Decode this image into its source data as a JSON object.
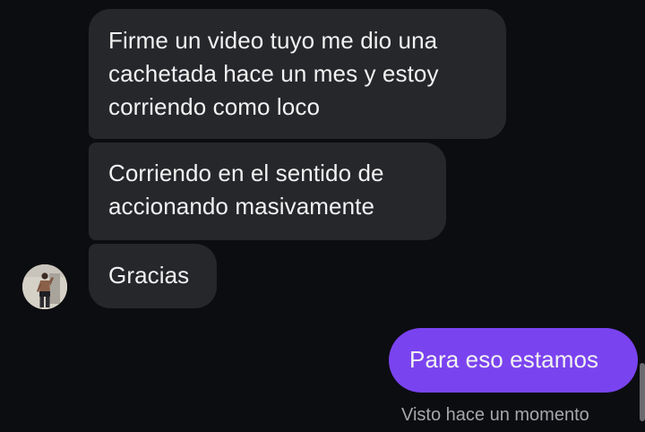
{
  "messages": [
    {
      "lines": [
        "Firme un video tuyo me dio una",
        "cachetada hace un mes y estoy",
        "corriendo como loco"
      ]
    },
    {
      "lines": [
        "Corriendo en el sentido de",
        "accionando masivamente"
      ]
    },
    {
      "lines": [
        "Gracias"
      ]
    }
  ],
  "reply": {
    "text": "Para eso estamos"
  },
  "seen_status": "Visto hace un momento",
  "colors": {
    "background": "#0c0d11",
    "incoming_bubble": "#26272b",
    "outgoing_bubble": "#7a43f0"
  }
}
